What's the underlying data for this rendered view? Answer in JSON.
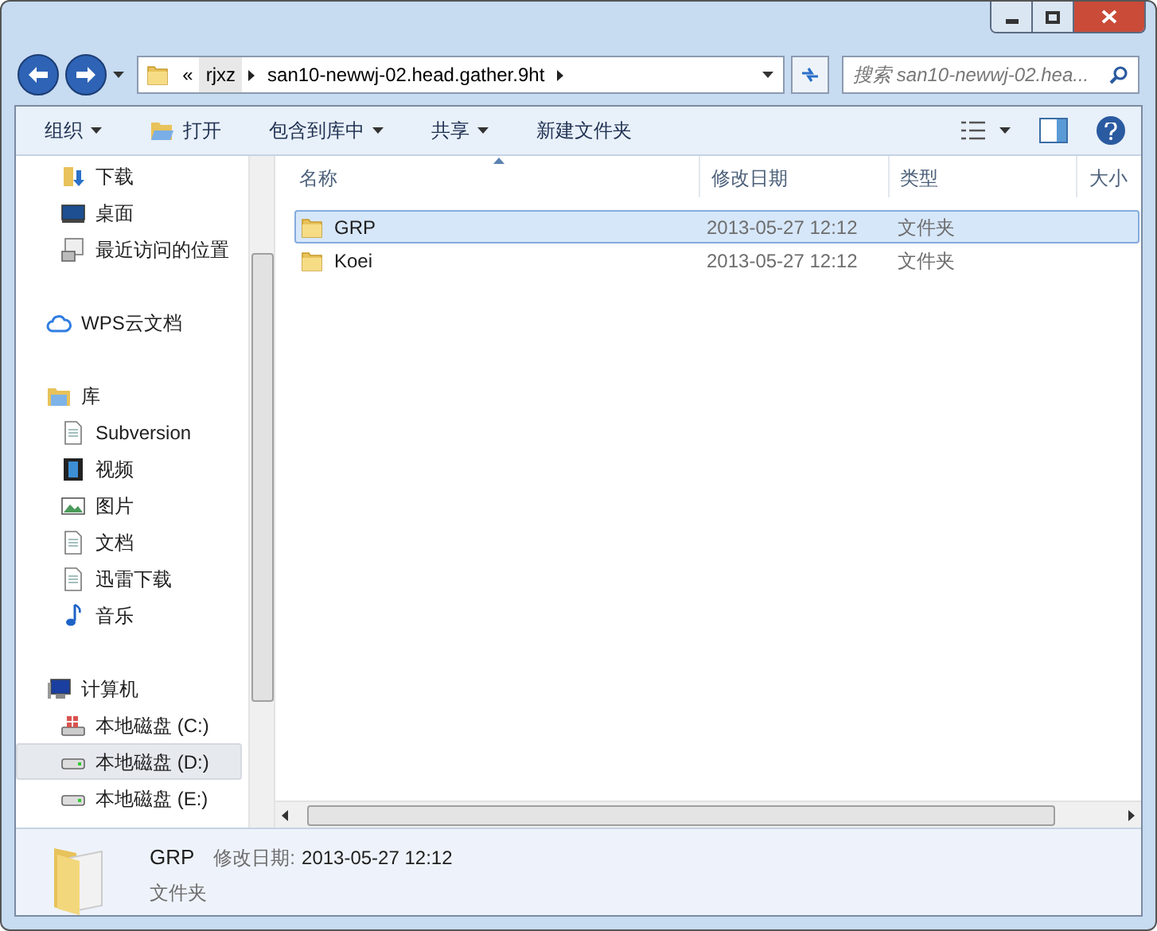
{
  "address": {
    "overflow": "«",
    "crumbs": [
      {
        "label": "rjxz"
      },
      {
        "label": "san10-newwj-02.head.gather.9ht"
      }
    ]
  },
  "search": {
    "placeholder": "搜索 san10-newwj-02.hea..."
  },
  "toolbar": [
    {
      "label": "组织",
      "kind": "menu"
    },
    {
      "label": "打开",
      "kind": "open"
    },
    {
      "label": "包含到库中",
      "kind": "menu"
    },
    {
      "label": "共享",
      "kind": "menu"
    },
    {
      "label": "新建文件夹",
      "kind": "plain"
    }
  ],
  "sidebar": {
    "sections": [
      {
        "children": [
          {
            "label": "下载",
            "kind": "download",
            "selected": false
          },
          {
            "label": "桌面",
            "kind": "desktop",
            "selected": false
          },
          {
            "label": "最近访问的位置",
            "kind": "recent",
            "selected": false
          }
        ]
      },
      {
        "label": "WPS云文档",
        "kind": "cloud",
        "selected": false
      },
      {
        "label": "库",
        "kind": "library",
        "selected": false,
        "children": [
          {
            "label": "Subversion",
            "kind": "doc",
            "selected": false
          },
          {
            "label": "视频",
            "kind": "video",
            "selected": false
          },
          {
            "label": "图片",
            "kind": "picture",
            "selected": false
          },
          {
            "label": "文档",
            "kind": "doc",
            "selected": false
          },
          {
            "label": "迅雷下载",
            "kind": "doc",
            "selected": false
          },
          {
            "label": "音乐",
            "kind": "music",
            "selected": false
          }
        ]
      },
      {
        "label": "计算机",
        "kind": "computer",
        "selected": false,
        "children": [
          {
            "label": "本地磁盘 (C:)",
            "kind": "sysdrive",
            "selected": false
          },
          {
            "label": "本地磁盘 (D:)",
            "kind": "drive",
            "selected": true
          },
          {
            "label": "本地磁盘 (E:)",
            "kind": "drive",
            "selected": false
          }
        ]
      }
    ]
  },
  "table": {
    "columns": [
      {
        "label": "名称",
        "sorted": true
      },
      {
        "label": "修改日期",
        "sorted": false
      },
      {
        "label": "类型",
        "sorted": false
      },
      {
        "label": "大小",
        "sorted": false
      }
    ],
    "rows": [
      {
        "name": "GRP",
        "date": "2013-05-27 12:12",
        "type": "文件夹",
        "selected": true
      },
      {
        "name": "Koei",
        "date": "2013-05-27 12:12",
        "type": "文件夹",
        "selected": false
      }
    ]
  },
  "details": {
    "name": "GRP",
    "date_label": "修改日期:",
    "date": "2013-05-27 12:12",
    "type": "文件夹"
  }
}
